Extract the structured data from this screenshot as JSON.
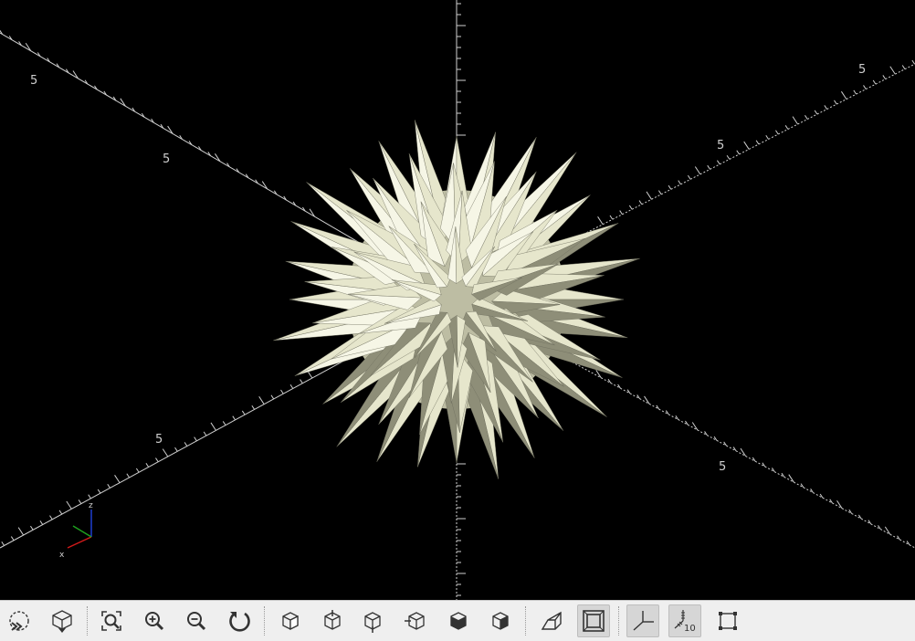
{
  "viewport": {
    "background": "#000000",
    "model": {
      "name": "spiky sphere",
      "fill": "#e6e6cc",
      "shade": "#8e8e78",
      "light": "#f6f6e6"
    },
    "axis_scale_labels": [
      "5",
      "5",
      "5",
      "5",
      "5",
      "5"
    ],
    "axes_gizmo": {
      "x_label": "x",
      "z_label": "z",
      "colors": {
        "x": "#d11a1a",
        "y": "#1fa11f",
        "z": "#1f3fd1"
      }
    }
  },
  "toolbar": {
    "buttons": [
      {
        "name": "preview-button",
        "icon": "preview-icon"
      },
      {
        "name": "render-button",
        "icon": "render-icon"
      },
      {
        "name": "view-all-button",
        "icon": "zoom-all-icon"
      },
      {
        "name": "zoom-in-button",
        "icon": "zoom-in-icon"
      },
      {
        "name": "zoom-out-button",
        "icon": "zoom-out-icon"
      },
      {
        "name": "reset-view-button",
        "icon": "reset-view-icon"
      },
      {
        "name": "view-right-button",
        "icon": "view-right-icon"
      },
      {
        "name": "view-top-button",
        "icon": "view-top-icon"
      },
      {
        "name": "view-bottom-button",
        "icon": "view-bottom-icon"
      },
      {
        "name": "view-left-button",
        "icon": "view-left-icon"
      },
      {
        "name": "view-front-button",
        "icon": "view-front-icon"
      },
      {
        "name": "view-back-button",
        "icon": "view-back-icon"
      },
      {
        "name": "perspective-button",
        "icon": "perspective-icon"
      },
      {
        "name": "orthogonal-button",
        "icon": "orthogonal-icon",
        "active": true
      },
      {
        "name": "show-axes-button",
        "icon": "axes-icon",
        "active": true
      },
      {
        "name": "show-scale-markers-button",
        "icon": "scale-markers-icon",
        "label": "10",
        "active": true
      },
      {
        "name": "show-edges-button",
        "icon": "edges-icon"
      }
    ]
  }
}
